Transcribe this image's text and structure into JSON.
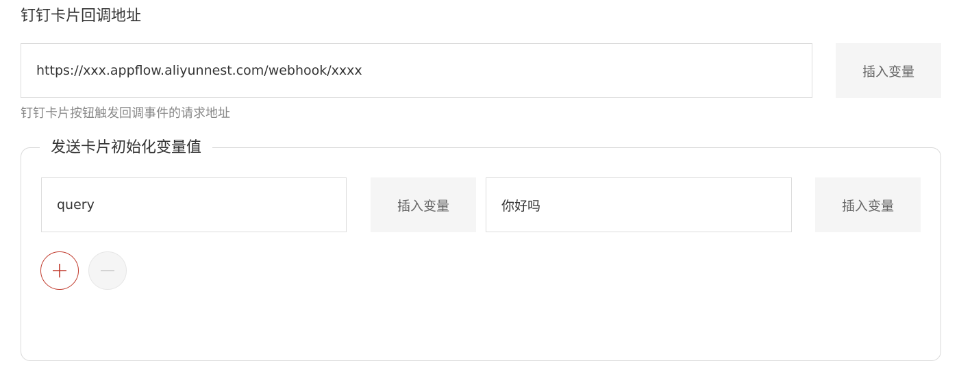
{
  "callback": {
    "title": "钉钉卡片回调地址",
    "url_value": "https://xxx.appflow.aliyunnest.com/webhook/xxxx",
    "insert_label": "插入变量",
    "helper": "钉钉卡片按钮触发回调事件的请求地址"
  },
  "init_vars": {
    "legend": "发送卡片初始化变量值",
    "rows": [
      {
        "key_value": "query",
        "key_insert_label": "插入变量",
        "value_value": "你好吗",
        "value_insert_label": "插入变量"
      }
    ],
    "add_icon": "plus-icon",
    "remove_icon": "minus-icon"
  },
  "colors": {
    "accent_red": "#c0392b",
    "button_bg": "#f5f5f5",
    "border": "#dcdcdc"
  }
}
